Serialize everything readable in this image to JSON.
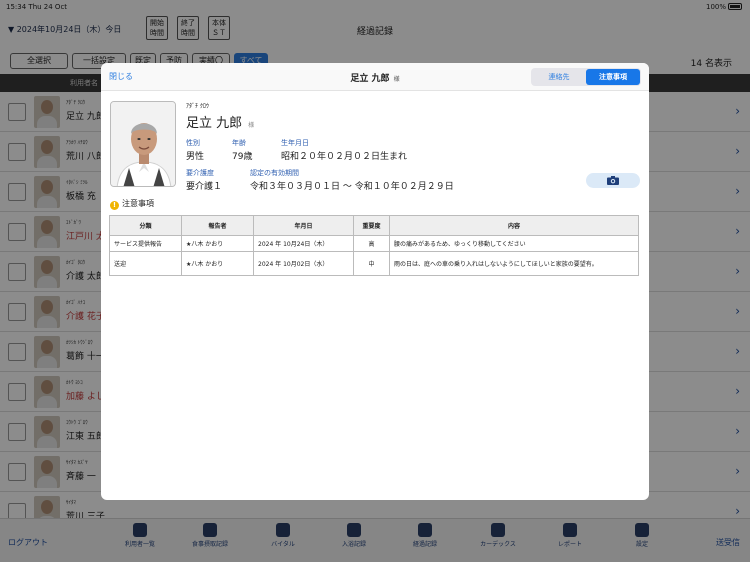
{
  "status": {
    "time": "15:34",
    "date": "Thu 24 Oct",
    "battery": "100%"
  },
  "header": {
    "date_selector": "▼ 2024年10月24日（木）今日",
    "start_btn": "開始\n時間",
    "end_btn": "終了\n時間",
    "body_btn": "本体\nＳＴ",
    "title": "経過記録"
  },
  "filters": {
    "select_all": "全選択",
    "bulk": "一括設定",
    "f1": "既定",
    "f2": "予防",
    "f3": "実績〇",
    "all": "すべて",
    "count": "14 名表示"
  },
  "list_header": "利用者名",
  "rows": [
    {
      "kana": "ｱﾀﾞﾁ ｸﾛｳ",
      "name": "足立 九郎",
      "red": false
    },
    {
      "kana": "ｱﾗｶﾜ ﾊﾁﾛｳ",
      "name": "荒川 八郎",
      "red": false
    },
    {
      "kana": "ｲﾀﾊﾞｼ ﾐﾂﾙ",
      "name": "板橋 充",
      "red": false
    },
    {
      "kana": "ｴﾄﾞｶﾞﾜ",
      "name": "江戸川 太",
      "red": true
    },
    {
      "kana": "ｶｲｺﾞ ﾀﾛｳ",
      "name": "介護 太郎",
      "red": false
    },
    {
      "kana": "ｶｲｺﾞ ﾊﾅｺ",
      "name": "介護 花子",
      "red": true
    },
    {
      "kana": "ｶﾂｼｶ ﾄｳｼﾞﾛｳ",
      "name": "葛飾 十一",
      "red": false
    },
    {
      "kana": "ｶﾄｳ ﾖｼｺ",
      "name": "加藤 よし",
      "red": true
    },
    {
      "kana": "ｺｳﾄｳ ｺﾞﾛｳ",
      "name": "江東 五郎",
      "red": false
    },
    {
      "kana": "ｻｲﾀﾏ ｶｽﾞﾔ",
      "name": "斉藤 一",
      "red": false
    },
    {
      "kana": "ｻｲﾀﾏ",
      "name": "荒川 三子",
      "red": false
    }
  ],
  "tabs": [
    "利用者一覧",
    "食事摂取記録",
    "バイタル",
    "入浴記録",
    "経過記録",
    "カーデックス",
    "レポート",
    "設定"
  ],
  "logout": "ログアウト",
  "resend": "送受信",
  "modal": {
    "close": "閉じる",
    "title": "足立 九郎",
    "sama": "様",
    "seg_contact": "連絡先",
    "seg_notes": "注意事項",
    "kana": "ｱﾀﾞﾁ ｸﾛｳ",
    "name": "足立 九郎",
    "name_sama": "様",
    "gender_label": "性別",
    "gender": "男性",
    "age_label": "年齢",
    "age": "79歳",
    "birth_label": "生年月日",
    "birth": "昭和２０年０２月０２日生まれ",
    "care_label": "要介護度",
    "care": "要介護１",
    "period_label": "認定の有効期間",
    "period": "令和３年０３月０１日 〜 令和１０年０２月２９日",
    "notice_title": "注意事項",
    "table": {
      "headers": [
        "分類",
        "報告者",
        "年月日",
        "重要度",
        "内容"
      ],
      "rows": [
        [
          "サービス提供報告",
          "★八木 かおり",
          "2024 年 10月24日（木）",
          "高",
          "腰の痛みがあるため、ゆっくり移動してください"
        ],
        [
          "送迎",
          "★八木 かおり",
          "2024 年 10月02日（水）",
          "中",
          "雨の日は、庭への車の乗り入れはしないようにしてほしいと家族の要望有。"
        ]
      ]
    }
  },
  "colors": {
    "accent": "#1877e8",
    "link": "#2f7fe0",
    "label": "#2f5fb0"
  }
}
